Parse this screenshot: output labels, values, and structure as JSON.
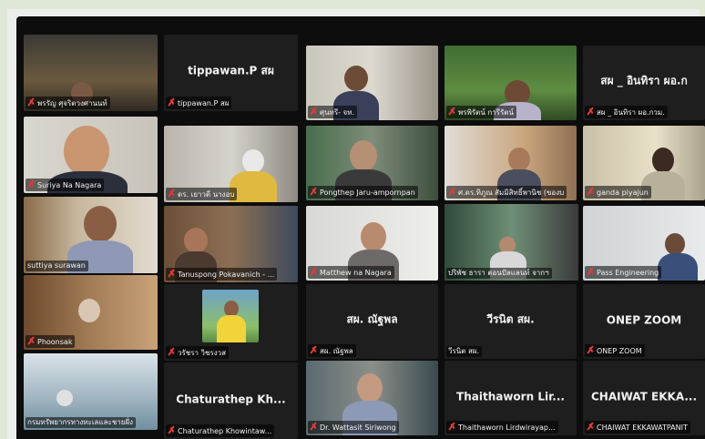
{
  "meeting": {
    "tiles": [
      {
        "id": "t1",
        "name": "พรรัญ ศุจริตวงศานนท์",
        "display": "",
        "muted": true
      },
      {
        "id": "t2",
        "name": "tippawan.P สผ",
        "display": "tippawan.P สผ",
        "muted": true
      },
      {
        "id": "t3",
        "name": "ศุนทรี- จท.",
        "display": "",
        "muted": true
      },
      {
        "id": "t4",
        "name": "พรพิรัตน์ การีรัตน์",
        "display": "",
        "muted": true
      },
      {
        "id": "t5",
        "name": "สผ _ อินทิรา ผอ.กวม.",
        "display": "สผ _ อินทิรา ผอ.ก",
        "muted": true
      },
      {
        "id": "t6",
        "name": "Suriya Na Nagara",
        "display": "",
        "muted": true
      },
      {
        "id": "t7",
        "name": "ดร. เยาวดี นางอบ",
        "display": "",
        "muted": true
      },
      {
        "id": "t8",
        "name": "Pongthep Jaru-ampornpan",
        "display": "",
        "muted": true
      },
      {
        "id": "t9",
        "name": "ศ.ดร.ทิภูณ สัมมิสิทธิ์พานิช (ของบ",
        "display": "",
        "muted": true
      },
      {
        "id": "t10",
        "name": "ganda piyajun",
        "display": "",
        "muted": true
      },
      {
        "id": "t11",
        "name": "suttiya surawan",
        "display": "",
        "muted": false
      },
      {
        "id": "t12",
        "name": "Tanuspong Pokavanich - ...",
        "display": "",
        "muted": true
      },
      {
        "id": "t13",
        "name": "Matthew na Nagara",
        "display": "",
        "muted": true
      },
      {
        "id": "t14",
        "name": "ปริพัช ธารา ตอนปัลแลนท์ จากฯ",
        "display": "",
        "muted": false
      },
      {
        "id": "t15",
        "name": "Pass Engineering",
        "display": "",
        "muted": true
      },
      {
        "id": "t16",
        "name": "Phoonsak",
        "display": "",
        "muted": true
      },
      {
        "id": "t17",
        "name": "วรัชรา วิชรงวส",
        "display": "",
        "muted": true
      },
      {
        "id": "t18",
        "name": "สผ. ณัฐพล",
        "display": "สผ. ณัฐพล",
        "muted": true
      },
      {
        "id": "t19",
        "name": "วีรนิต สผ.",
        "display": "วีรนิต สผ.",
        "muted": false
      },
      {
        "id": "t20",
        "name": "ONEP ZOOM",
        "display": "ONEP ZOOM",
        "muted": true
      },
      {
        "id": "t21",
        "name": "กรมทรัพยากรทางทะเลและชายฝั่ง",
        "display": "",
        "muted": false
      },
      {
        "id": "t22",
        "name": "Chaturathep Khowintaw...",
        "display": "Chaturathep Kh...",
        "muted": true
      },
      {
        "id": "t23",
        "name": "Dr. Wattasit Siriwong",
        "display": "",
        "muted": true
      },
      {
        "id": "t24",
        "name": "Thaithaworn Lirdwirayap...",
        "display": "Thaithaworn Lir...",
        "muted": true
      },
      {
        "id": "t25",
        "name": "CHAIWAT EKKAWATPANIT",
        "display": "CHAIWAT EKKA...",
        "muted": true
      }
    ],
    "colors": {
      "mute_icon": "#e03a3a",
      "active_speaker_border": "#e7e44b",
      "tile_background": "#1e1e1e",
      "screen_background": "#0d0d0d"
    }
  }
}
